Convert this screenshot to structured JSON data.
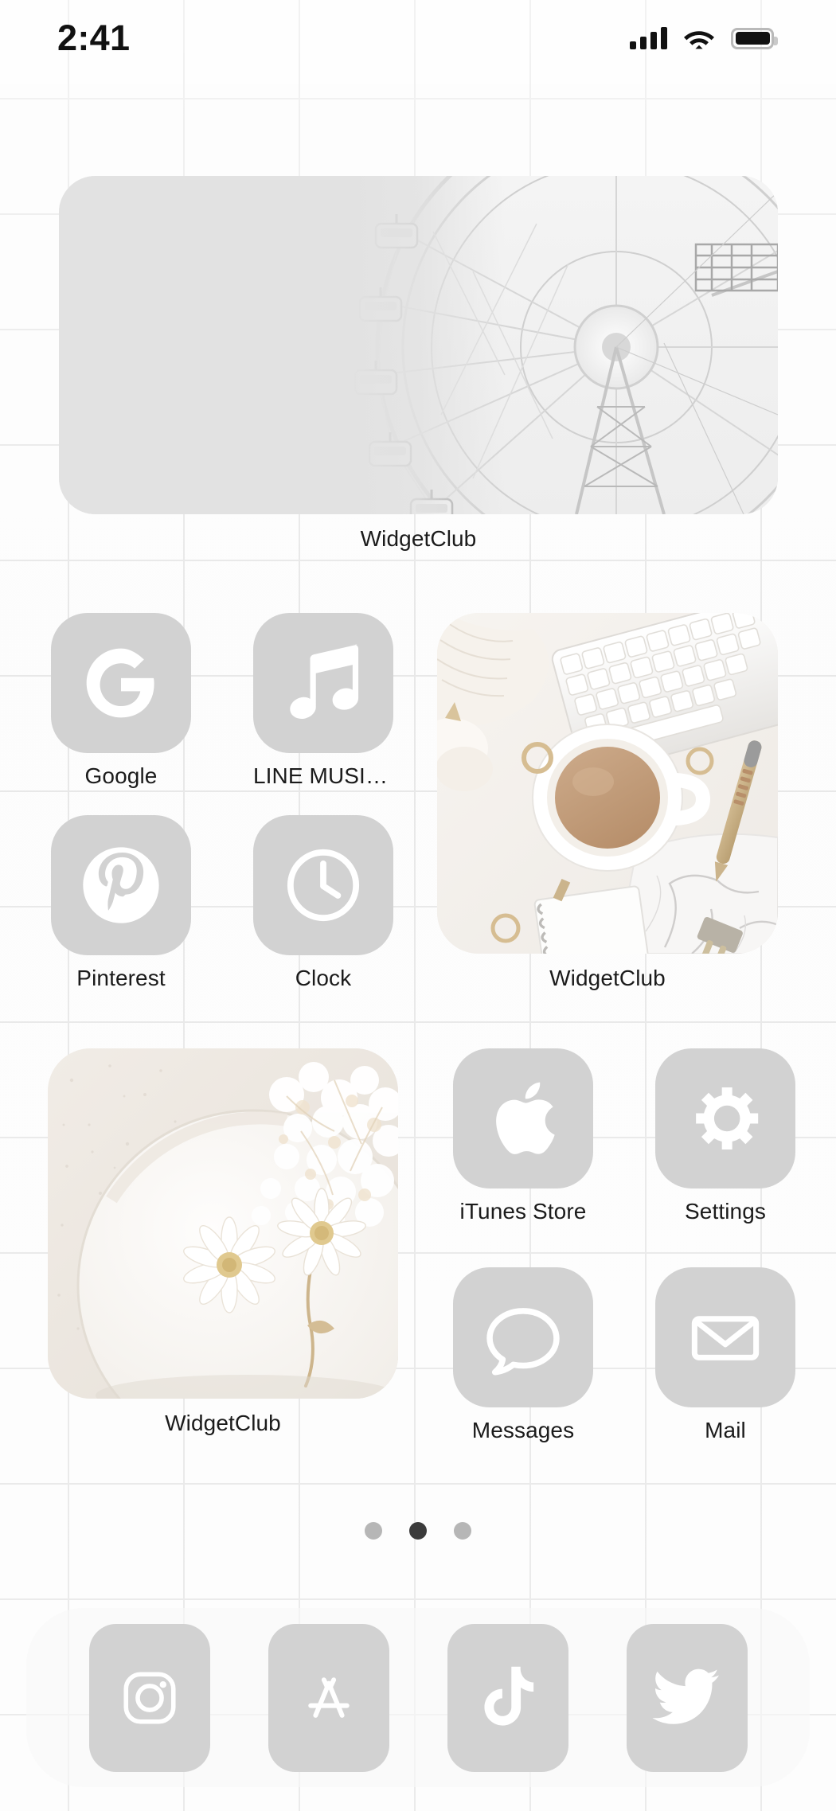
{
  "status_bar": {
    "time": "2:41",
    "signal_icon": "cellular-signal-icon",
    "signal_bars": 4,
    "wifi_icon": "wifi-icon",
    "battery_icon": "battery-full-icon"
  },
  "home_screen": {
    "wallpaper": "white-grid-tile",
    "grid_line_color": "#e3e3e3",
    "icon_tile_color": "#d2d2d2",
    "icon_glyph_color": "#ffffff",
    "label_color": "#1b1b1b"
  },
  "widgets": [
    {
      "id": "ferris-wheel",
      "label": "WidgetClub",
      "size": "4x2",
      "art": "black-and-white-ferris-wheel-photo"
    },
    {
      "id": "coffee-desk",
      "label": "WidgetClub",
      "size": "2x2",
      "art": "white-desk-flatlay-coffee-keyboard-photo"
    },
    {
      "id": "daisy-plate",
      "label": "WidgetClub",
      "size": "2x2",
      "art": "white-daisies-on-ceramic-plate-photo"
    }
  ],
  "apps": [
    {
      "id": "google",
      "label": "Google",
      "icon": "google-g-icon"
    },
    {
      "id": "line-music",
      "label": "LINE MUSIC 音…",
      "icon": "music-note-icon"
    },
    {
      "id": "pinterest",
      "label": "Pinterest",
      "icon": "pinterest-icon"
    },
    {
      "id": "clock",
      "label": "Clock",
      "icon": "clock-icon"
    },
    {
      "id": "itunes-store",
      "label": "iTunes Store",
      "icon": "apple-logo-icon"
    },
    {
      "id": "settings",
      "label": "Settings",
      "icon": "gear-icon"
    },
    {
      "id": "messages",
      "label": "Messages",
      "icon": "speech-bubble-icon"
    },
    {
      "id": "mail",
      "label": "Mail",
      "icon": "envelope-icon"
    }
  ],
  "page_indicator": {
    "total_pages": 3,
    "current_page": 2
  },
  "dock": {
    "apps": [
      {
        "id": "instagram",
        "icon": "instagram-icon"
      },
      {
        "id": "app-store",
        "icon": "app-store-icon"
      },
      {
        "id": "tiktok",
        "icon": "tiktok-icon"
      },
      {
        "id": "twitter",
        "icon": "twitter-bird-icon"
      }
    ]
  }
}
